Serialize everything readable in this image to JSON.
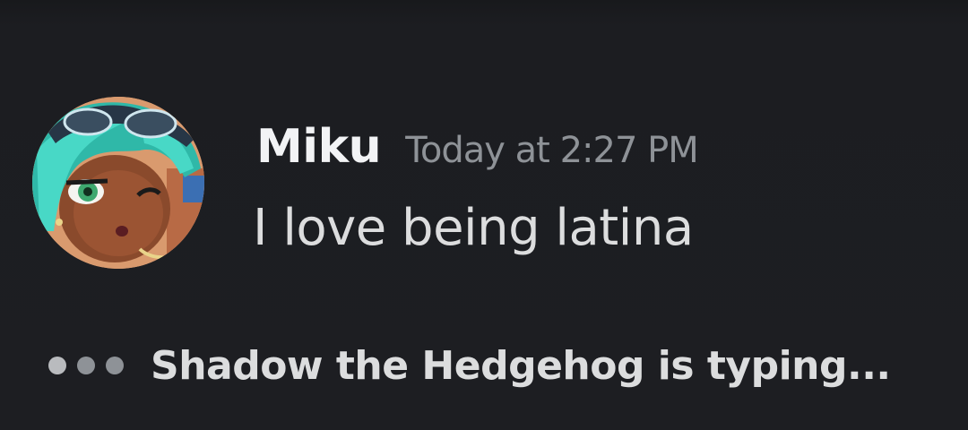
{
  "message": {
    "avatar_icon": "anime-avatar-icon",
    "username": "Miku",
    "timestamp": "Today at 2:27 PM",
    "content": "I love being latina"
  },
  "typing_indicator": {
    "user": "Shadow the Hedgehog",
    "suffix": " is typing..."
  },
  "colors": {
    "background": "#1c1d21",
    "username": "#f2f3f5",
    "timestamp": "#8e9297",
    "message_text": "#dcddde",
    "avatar_hair": "#3fd0bf"
  }
}
